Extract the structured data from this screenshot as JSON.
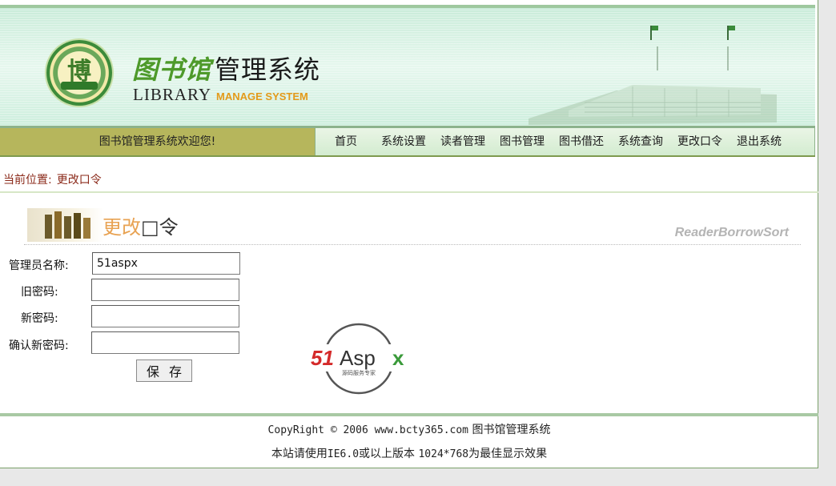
{
  "banner": {
    "seal_char": "博",
    "title_calli": "图书馆",
    "title_rest": "管理系统",
    "title_en_library": "LIBRARY",
    "title_en_manage": "MANAGE SYSTEM"
  },
  "nav": {
    "welcome": "图书馆管理系统欢迎您!",
    "items": [
      "首页",
      "系统设置",
      "读者管理",
      "图书管理",
      "图书借还",
      "系统查询",
      "更改口令",
      "退出系统"
    ]
  },
  "location": {
    "label": "当前位置:",
    "current": "更改口令"
  },
  "section": {
    "title_part1": "更改",
    "title_part2": "□令",
    "subtitle": "ReaderBorrowSort"
  },
  "form": {
    "admin_name_label": "管理员名称:",
    "admin_name_value": "51aspx",
    "old_password_label": "旧密码:",
    "new_password_label": "新密码:",
    "confirm_password_label": "确认新密码:",
    "save_label": "保存"
  },
  "logo51": {
    "brand_red": "51",
    "brand_black": "Asp",
    "brand_green": "x",
    "tagline": "源码服务专家"
  },
  "footer": {
    "copyright_prefix": "CopyRight © 2006 www.bcty365.com",
    "copyright_suffix": "图书馆管理系统",
    "browser_prefix": "本站请使用",
    "browser_mid": "IE6.0",
    "browser_mid2": "或以上版本",
    "resolution": "1024*768",
    "browser_suffix": "为最佳显示效果"
  },
  "colors": {
    "welcome_bg": "#b6b65c",
    "location_text": "#8b2a1a",
    "title_orange": "#e8a252",
    "manage_orange": "#e39a1a",
    "aspx_red": "#d42a2a",
    "aspx_green": "#3a9a3a"
  },
  "icons": {
    "seal": "library-seal-icon",
    "books": "books-graphic-icon",
    "aspx": "51aspx-logo-icon"
  }
}
